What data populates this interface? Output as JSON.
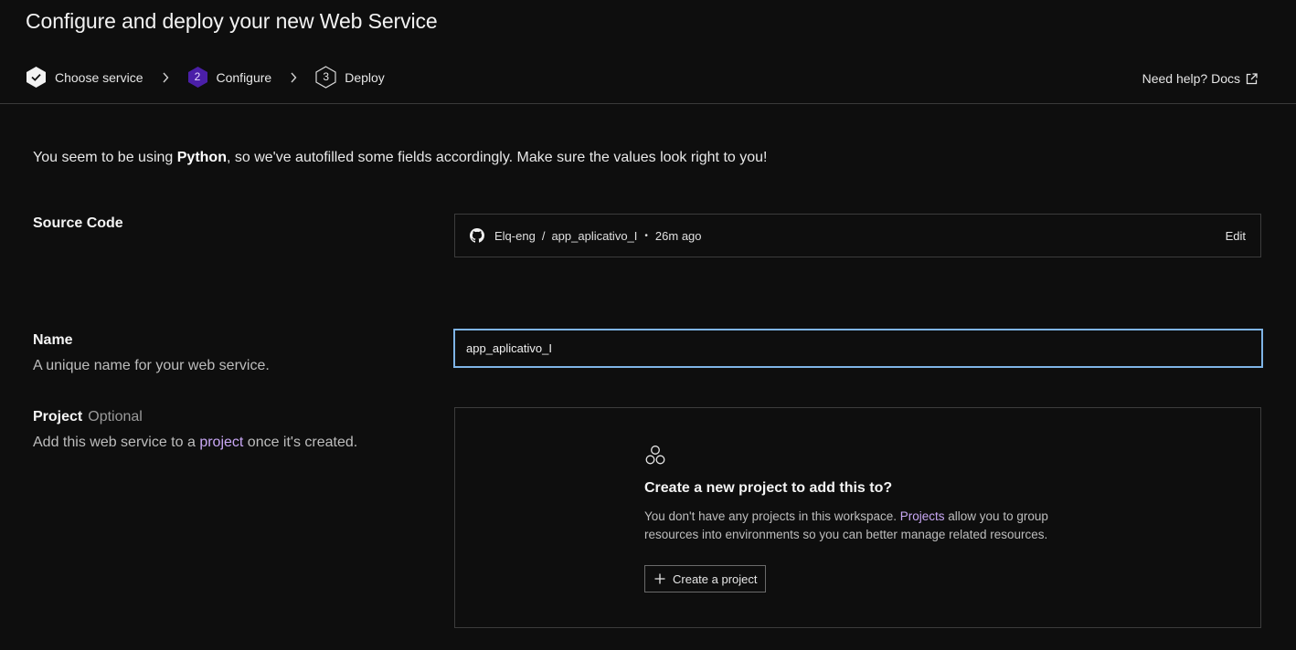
{
  "page": {
    "title": "Configure and deploy your new Web Service"
  },
  "steps": [
    {
      "number": "",
      "label": "Choose service",
      "state": "done"
    },
    {
      "number": "2",
      "label": "Configure",
      "state": "active"
    },
    {
      "number": "3",
      "label": "Deploy",
      "state": "pending"
    }
  ],
  "help": {
    "label": "Need help? Docs"
  },
  "notice": {
    "prefix": "You seem to be using ",
    "language": "Python",
    "suffix": ", so we've autofilled some fields accordingly. Make sure the values look right to you!"
  },
  "source_code": {
    "label": "Source Code",
    "owner": "Elq-eng",
    "separator": "/",
    "repo": "app_aplicativo_I",
    "dot": "•",
    "updated": "26m ago",
    "edit_label": "Edit"
  },
  "name_field": {
    "label": "Name",
    "description": "A unique name for your web service.",
    "value": "app_aplicativo_I"
  },
  "project_field": {
    "label": "Project",
    "optional": "Optional",
    "desc_prefix": "Add this web service to a ",
    "desc_link": "project",
    "desc_suffix": " once it's created."
  },
  "project_empty": {
    "title": "Create a new project to add this to?",
    "text_prefix": "You don't have any projects in this workspace. ",
    "text_link": "Projects",
    "text_suffix": " allow you to group resources into environments so you can better manage related resources.",
    "button_label": "Create a project"
  },
  "colors": {
    "background": "#0e0e0e",
    "accent_purple": "#4b1fa8",
    "link_purple": "#c9a8f5",
    "focus_blue": "#7fb4e6"
  }
}
